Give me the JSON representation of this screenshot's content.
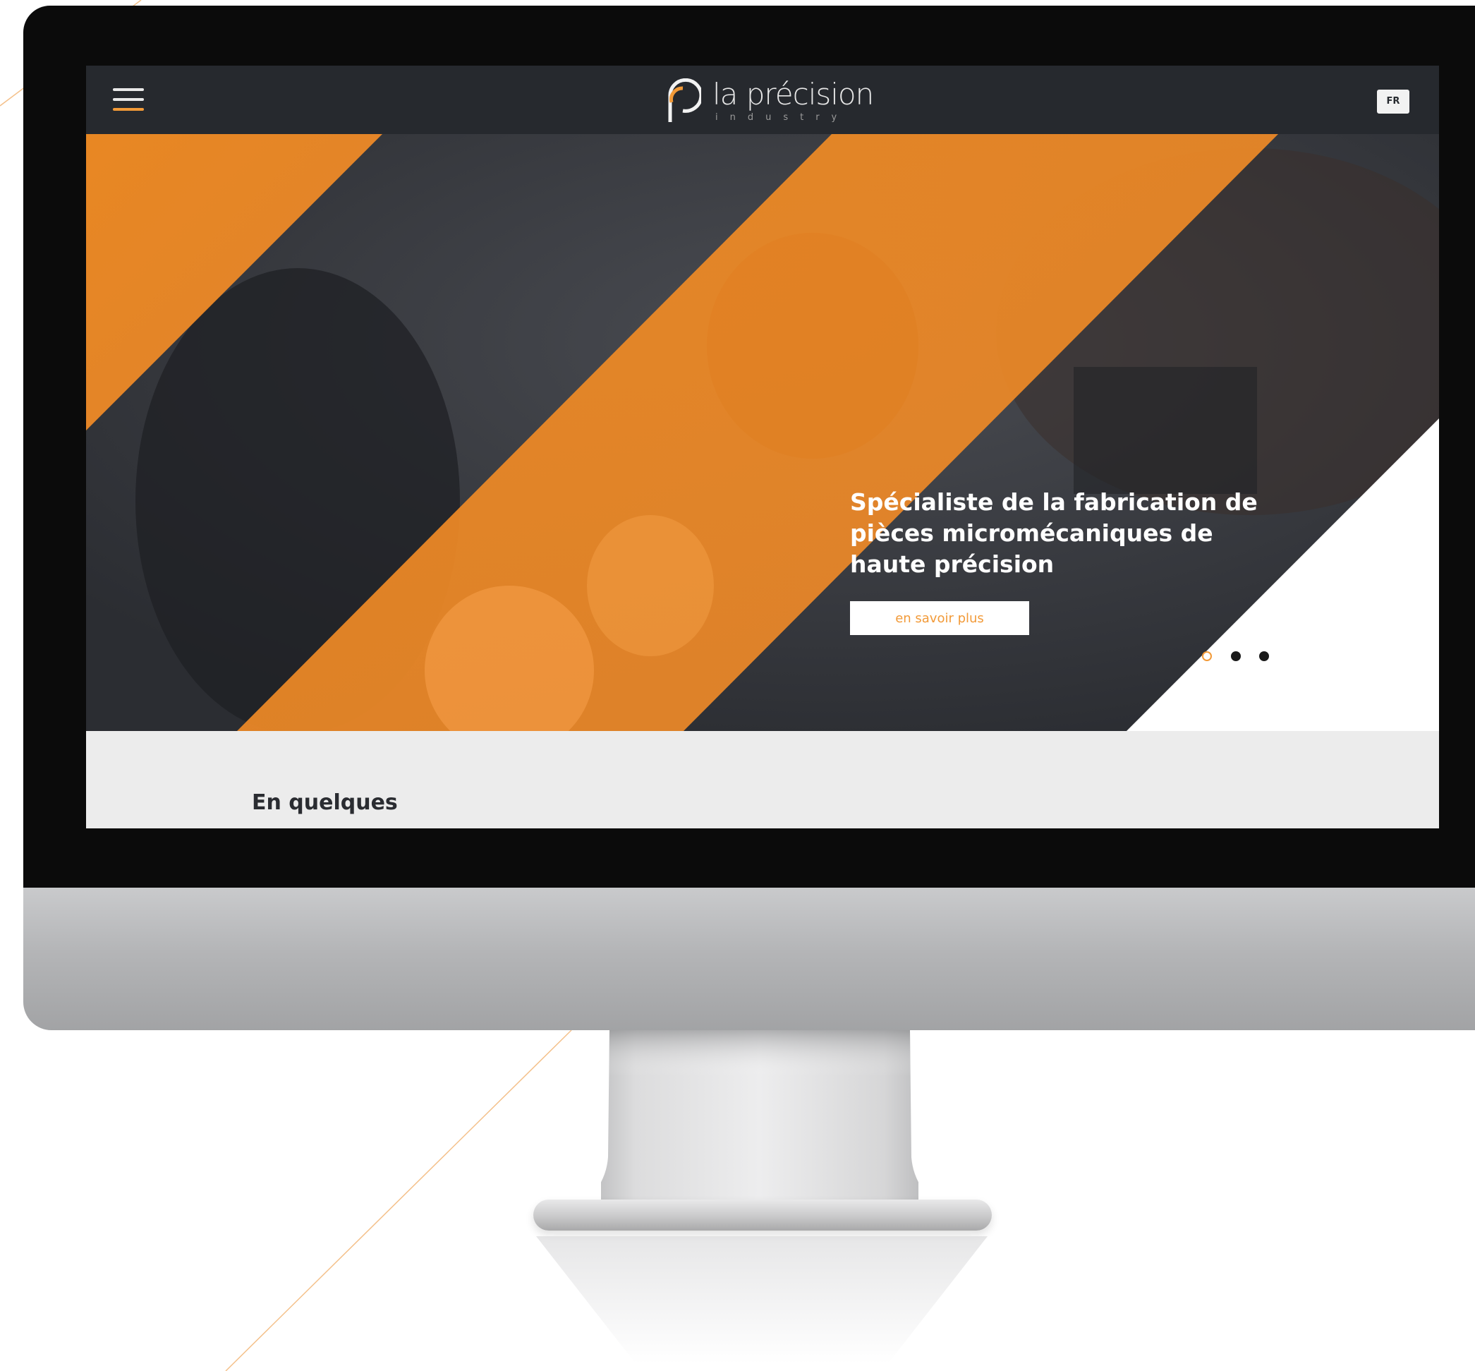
{
  "site": {
    "brand_word": "la précision",
    "brand_sub": "industry",
    "lang_label": "FR"
  },
  "hero": {
    "headline": "Spécialiste de la fabrication de pièces micromécaniques de haute précision",
    "cta_label": "en savoir plus",
    "slides_total": 3,
    "slide_active": 1
  },
  "section": {
    "title": "En quelques"
  },
  "colors": {
    "accent": "#f29a38",
    "dark": "#26292e",
    "light": "#ececec",
    "white": "#ffffff"
  },
  "icons": {
    "menu": "hamburger-icon",
    "logo": "p-monogram-logo"
  }
}
